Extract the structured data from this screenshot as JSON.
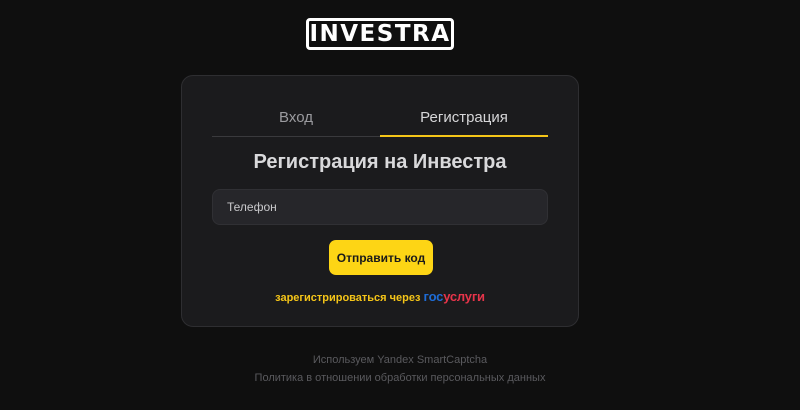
{
  "brand": {
    "logo_text": "INVESTRA"
  },
  "auth": {
    "tabs": [
      {
        "label": "Вход",
        "active": false
      },
      {
        "label": "Регистрация",
        "active": true
      }
    ],
    "title": "Регистрация на Инвестра",
    "phone_placeholder": "Телефон",
    "phone_value": "",
    "send_code_label": "Отправить код",
    "gosuslugi": {
      "prefix": "зарегистрироваться через",
      "logo_part1": "гос",
      "logo_part2": "услуги"
    }
  },
  "footer": {
    "captcha_note": "Используем Yandex SmartCaptcha",
    "privacy_link": "Политика в отношении обработки персональных данных"
  },
  "colors": {
    "background": "#0f0f0f",
    "card": "#1b1b1d",
    "accent": "#fdd515",
    "gosuslugi_blue": "#1e6cd6",
    "gosuslugi_red": "#e6344a"
  }
}
